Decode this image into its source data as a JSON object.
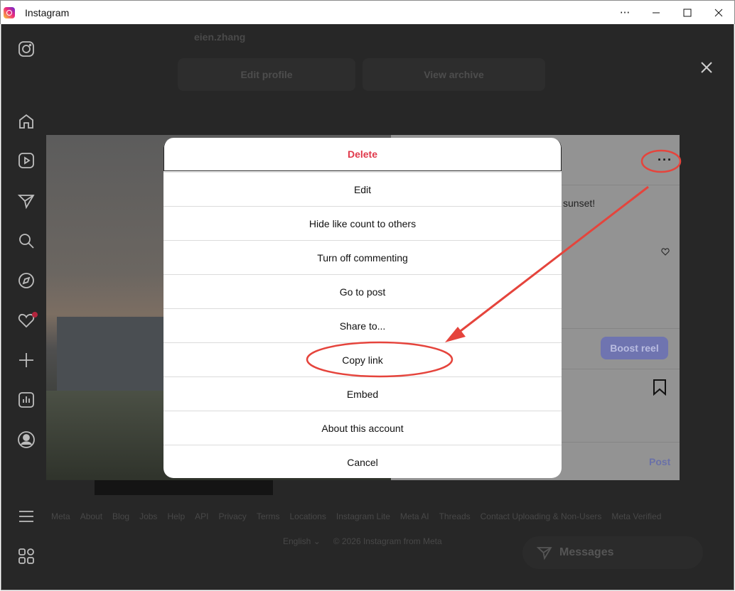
{
  "window": {
    "title": "Instagram",
    "more_label": "···",
    "minimize_label": "—",
    "maximize_label": "☐",
    "close_label": "✕"
  },
  "profile": {
    "username": "eien.zhang",
    "edit_profile_label": "Edit profile",
    "view_archive_label": "View archive"
  },
  "post": {
    "caption_fragment": "l sunset!",
    "boost_label": "Boost reel",
    "post_label": "Post",
    "more_options_label": "···"
  },
  "options_dialog": {
    "items": [
      {
        "label": "Delete",
        "style": "destructive"
      },
      {
        "label": "Edit"
      },
      {
        "label": "Hide like count to others"
      },
      {
        "label": "Turn off commenting"
      },
      {
        "label": "Go to post"
      },
      {
        "label": "Share to..."
      },
      {
        "label": "Copy link",
        "highlighted": true
      },
      {
        "label": "Embed"
      },
      {
        "label": "About this account"
      },
      {
        "label": "Cancel"
      }
    ]
  },
  "footer": {
    "links": [
      "Meta",
      "About",
      "Blog",
      "Jobs",
      "Help",
      "API",
      "Privacy",
      "Terms",
      "Locations",
      "Instagram Lite",
      "Meta AI",
      "Threads",
      "Contact Uploading & Non-Users",
      "Meta Verified"
    ],
    "language": "English ⌄",
    "copyright": "© 2026 Instagram from Meta"
  },
  "messages": {
    "label": "Messages"
  },
  "colors": {
    "destructive": "#e0394b",
    "annotation": "#e5443c",
    "accent": "#6f74b0"
  },
  "sidebar_icons": [
    "instagram-icon",
    "home-icon",
    "reels-icon",
    "direct-icon",
    "search-icon",
    "explore-icon",
    "heart-icon",
    "create-icon",
    "insights-icon",
    "profile-icon",
    "menu-icon",
    "more-apps-icon"
  ]
}
